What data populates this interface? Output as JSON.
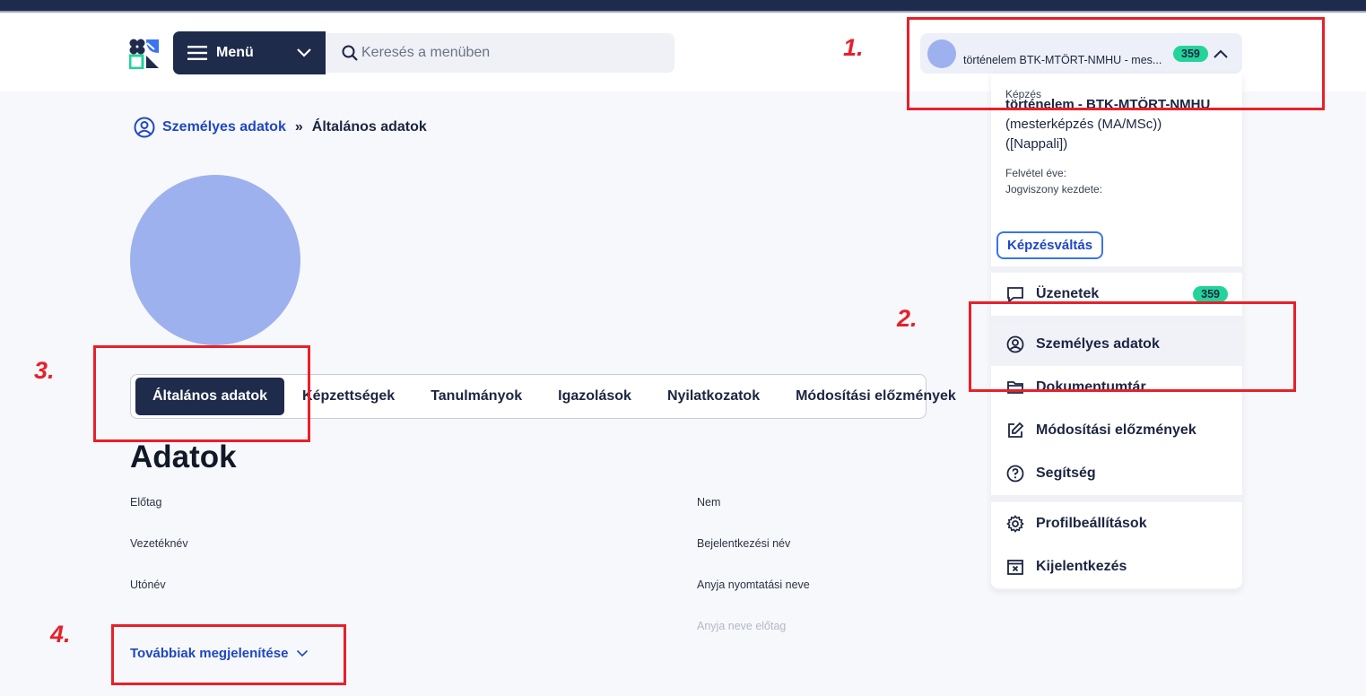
{
  "header": {
    "menu_label": "Menü",
    "search_placeholder": "Keresés a menüben",
    "profile_chip_text": "történelem BTK-MTÖRT-NMHU - mes...",
    "profile_badge": "359"
  },
  "breadcrumb": {
    "parent": "Személyes adatok",
    "separator": "»",
    "current": "Általános adatok"
  },
  "tabs": [
    {
      "label": "Általános adatok",
      "active": true
    },
    {
      "label": "Képzettségek"
    },
    {
      "label": "Tanulmányok"
    },
    {
      "label": "Igazolások"
    },
    {
      "label": "Nyilatkozatok"
    },
    {
      "label": "Módosítási előzmények"
    }
  ],
  "section_title": "Adatok",
  "fields_left": [
    "Előtag",
    "Vezetéknév",
    "Utónév"
  ],
  "fields_right": [
    "Nem",
    "Bejelentkezési név",
    "Anyja nyomtatási neve",
    "Anyja neve előtag"
  ],
  "more_link": "Továbbiak megjelenítése",
  "dropdown": {
    "section_label": "Képzés",
    "program_name": "történelem - BTK-MTÖRT-NMHU",
    "program_detail_1": "(mesterképzés (MA/MSc))",
    "program_detail_2": "([Nappali])",
    "admission_year_label": "Felvétel éve:",
    "enrollment_start_label": "Jogviszony kezdete:",
    "switch_button": "Képzésváltás",
    "items": [
      {
        "label": "Üzenetek",
        "badge": "359",
        "icon": "chat-icon"
      },
      {
        "label": "Személyes adatok",
        "icon": "user-circle-icon",
        "active": true
      },
      {
        "label": "Dokumentumtár",
        "icon": "folder-icon"
      },
      {
        "label": "Módosítási előzmények",
        "icon": "edit-icon"
      },
      {
        "label": "Segítség",
        "icon": "help-icon"
      },
      {
        "label": "Profilbeállítások",
        "icon": "gear-icon"
      },
      {
        "label": "Kijelentkezés",
        "icon": "logout-icon"
      }
    ]
  },
  "annotations": [
    "1.",
    "2.",
    "3.",
    "4."
  ],
  "colors": {
    "navy": "#1e2b4b",
    "link_blue": "#1f47c4",
    "badge_green": "#23d49a",
    "annotation_red": "#e8202a",
    "avatar_blue": "#9db1ee"
  }
}
